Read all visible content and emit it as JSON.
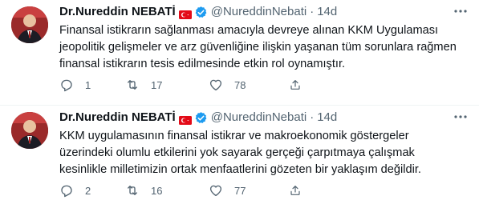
{
  "tweets": [
    {
      "name": "Dr.Nureddin NEBATİ",
      "handle": "@NureddinNebati",
      "separator": "·",
      "time": "14d",
      "text": "Finansal istikrarın sağlanması amacıyla devreye alınan KKM Uygulaması\njeopolitik gelişmeler ve arz güvenliğine ilişkin yaşanan tüm sorunlara rağmen\nfinansal istikrarın tesis edilmesinde etkin rol oynamıştır.",
      "replies": "1",
      "retweets": "17",
      "likes": "78"
    },
    {
      "name": "Dr.Nureddin NEBATİ",
      "handle": "@NureddinNebati",
      "separator": "·",
      "time": "14d",
      "text": "KKM uygulamasının finansal istikrar ve makroekonomik göstergeler\nüzerindeki olumlu etkilerini yok sayarak gerçeği çarpıtmaya çalışmak\nkesinlikle milletimizin ortak menfaatlerini gözeten bir yaklaşım değildir.",
      "replies": "2",
      "retweets": "16",
      "likes": "77"
    }
  ],
  "icons": {
    "flag": "turkey-flag-icon",
    "verified": "verified-badge-icon",
    "more": "more-options-icon",
    "reply": "reply-icon",
    "retweet": "retweet-icon",
    "like": "heart-icon",
    "share": "share-icon"
  },
  "colors": {
    "text": "#0f1419",
    "secondary": "#536471",
    "verified": "#1d9bf0",
    "flag": "#e30a17"
  }
}
